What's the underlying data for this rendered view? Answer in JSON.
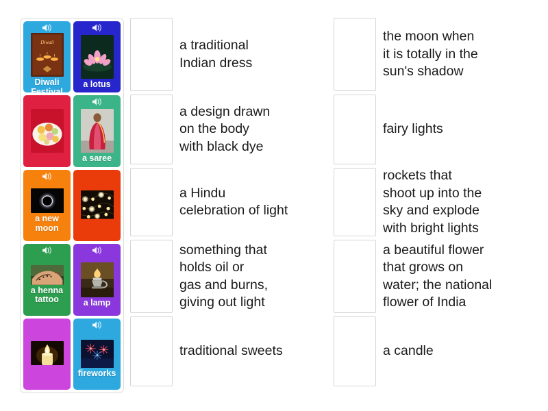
{
  "activity": {
    "type": "match-up",
    "icons": {
      "speaker": "speaker-icon"
    }
  },
  "cards": [
    {
      "id": "diwali-festival",
      "label": "Diwali\nFestival",
      "bg": "#2ea9e0",
      "has_speaker": true,
      "image": "diwali-greeting-card-with-diyas",
      "image_alt": "Happy Diwali greeting card with oil lamps on brown background"
    },
    {
      "id": "a-lotus",
      "label": "a\nlotus",
      "bg": "#2626cc",
      "has_speaker": true,
      "image": "pink-lotus-flower-on-water",
      "image_alt": "Pink lotus flower floating on dark water"
    },
    {
      "id": "traditional-sweets",
      "label": "",
      "bg": "#e02040",
      "has_speaker": false,
      "image": "plate-of-indian-sweets",
      "image_alt": "Plate of colourful Indian sweets"
    },
    {
      "id": "a-saree",
      "label": "a saree",
      "bg": "#3cb489",
      "has_speaker": true,
      "image": "woman-wearing-red-saree",
      "image_alt": "Woman wearing a red and pink saree"
    },
    {
      "id": "a-new-moon",
      "label": "a new\nmoon",
      "bg": "#f6820d",
      "has_speaker": true,
      "image": "solar-eclipse-dark-moon",
      "image_alt": "Dark new moon with glowing corona on black sky"
    },
    {
      "id": "fairy-lights",
      "label": "",
      "bg": "#ea3c0a",
      "has_speaker": false,
      "image": "string-of-fairy-lights",
      "image_alt": "String of warm white fairy lights on dark background"
    },
    {
      "id": "a-henna-tattoo",
      "label": "a henna\ntattoo",
      "bg": "#2d9d4f",
      "has_speaker": true,
      "image": "henna-tattoo-on-hand",
      "image_alt": "Henna design being drawn on a hand"
    },
    {
      "id": "a-lamp",
      "label": "a lamp",
      "bg": "#8a38dd",
      "has_speaker": true,
      "image": "oil-lamp-lantern",
      "image_alt": "Antique oil lamp burning in a dim room"
    },
    {
      "id": "a-candle",
      "label": "",
      "bg": "#cc45dd",
      "has_speaker": false,
      "image": "lit-candle-flame",
      "image_alt": "Lit candle with a bright flame"
    },
    {
      "id": "fireworks",
      "label": "fireworks",
      "bg": "#2ea9e0",
      "has_speaker": true,
      "image": "fireworks-in-night-sky",
      "image_alt": "Red and blue fireworks exploding in a night sky"
    }
  ],
  "definitions_left": [
    {
      "id": "def-saree",
      "text": "a traditional\nIndian dress"
    },
    {
      "id": "def-henna",
      "text": "a design drawn\non the body\nwith black dye"
    },
    {
      "id": "def-diwali",
      "text": "a Hindu\ncelebration of light"
    },
    {
      "id": "def-lamp",
      "text": "something that\nholds oil or\ngas and burns,\ngiving out light"
    },
    {
      "id": "def-sweets",
      "text": "traditional sweets"
    }
  ],
  "definitions_right": [
    {
      "id": "def-newmoon",
      "text": "the moon when\nit is totally in the\nsun's shadow"
    },
    {
      "id": "def-fairy",
      "text": "fairy lights"
    },
    {
      "id": "def-fireworks",
      "text": "rockets that\nshoot up into the\nsky and explode\nwith bright lights"
    },
    {
      "id": "def-lotus",
      "text": "a beautiful flower\nthat grows on\nwater; the national\nflower of India"
    },
    {
      "id": "def-candle",
      "text": "a candle"
    }
  ]
}
